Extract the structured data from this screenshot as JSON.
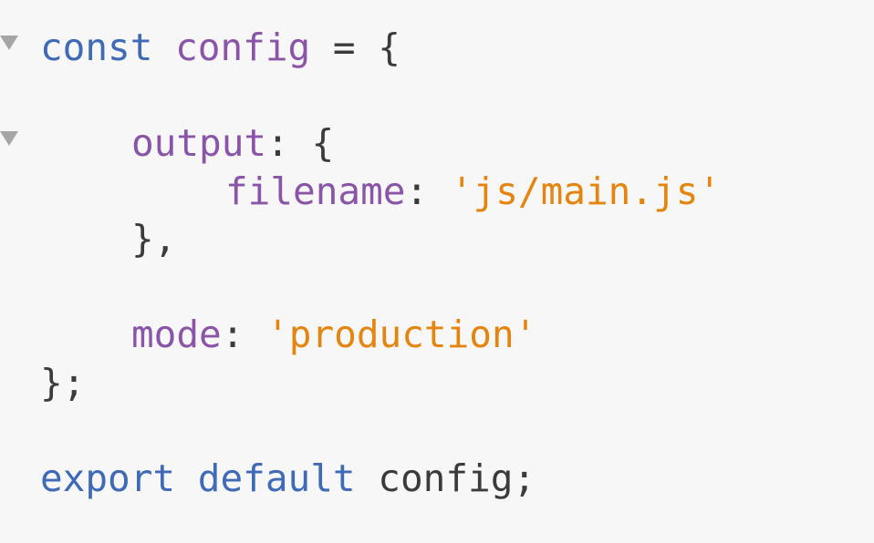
{
  "colors": {
    "background": "#f7f7f7",
    "keyword": "#3e6ab7",
    "identifier": "#8a55a9",
    "string": "#e5850f",
    "punctuation": "#3b3b3b",
    "fold_marker": "#a6a6a6"
  },
  "gutter": {
    "fold_icon": "fold-triangle-down-icon"
  },
  "code": {
    "l1": {
      "kw": "const",
      "name": "config",
      "op": " = {"
    },
    "l3": {
      "prop": "output",
      "punc": ": {"
    },
    "l4": {
      "prop": "filename",
      "punc": ": ",
      "str": "'js/main.js'"
    },
    "l5": {
      "punc": "},"
    },
    "l7": {
      "prop": "mode",
      "punc": ": ",
      "str": "'production'"
    },
    "l8": {
      "punc": "};"
    },
    "l10": {
      "kw1": "export",
      "kw2": "default",
      "name": "config",
      "punc": ";"
    }
  }
}
